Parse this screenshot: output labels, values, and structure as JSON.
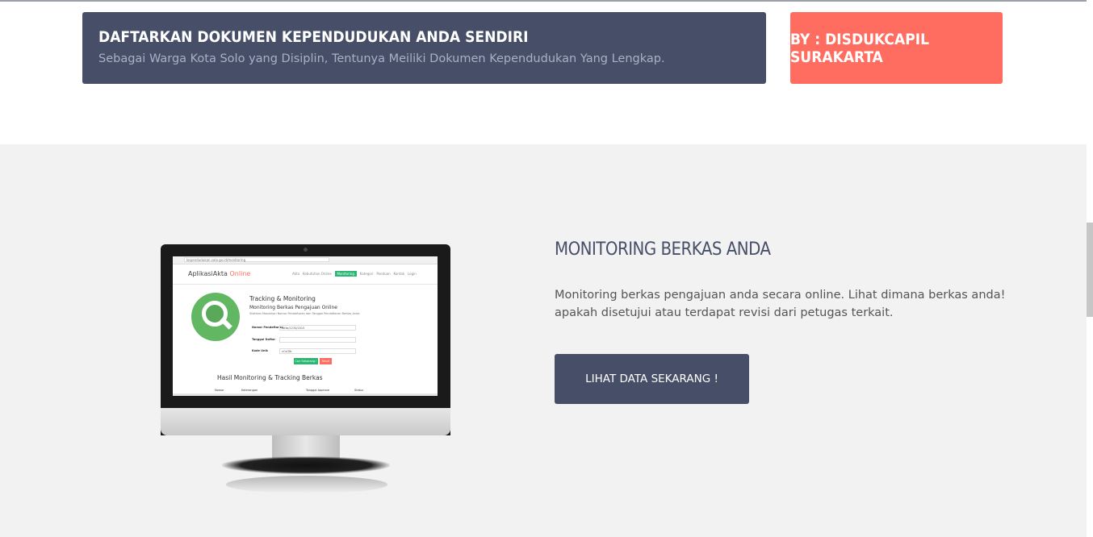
{
  "banner": {
    "title": "DAFTARKAN DOKUMEN KEPENDUDUKAN ANDA SENDIRI",
    "subtitle": "Sebagai Warga Kota Solo yang Disiplin, Tentunya Meiliki Dokumen Kependudukan Yang Lengkap.",
    "by_label": "BY : DISDUKCAPIL SURAKARTA"
  },
  "monitoring": {
    "title": "MONITORING BERKAS ANDA",
    "description": "Monitoring berkas pengajuan anda secara online. Lihat dimana berkas anda! apakah disetujui atau terdapat revisi dari petugas terkait.",
    "button_label": "LIHAT DATA SEKARANG !"
  },
  "screen": {
    "url": "kependudukan.solo.go.id/monitoring",
    "brand_main": "AplikasiAkta",
    "brand_accent": "Online",
    "nav": [
      "Akta",
      "Kebutuhan Online",
      "Monitoring",
      "Kategori",
      "Panduan",
      "Kontak",
      "Login"
    ],
    "heading": "Tracking & Monitoring",
    "subheading": "Monitoring Berkas Pengajuan Online",
    "instruction": "Silahkan Masukkan Nomor Pendaftaran dan Tanggal Pendaftaran Berkas Anda",
    "fields": [
      {
        "label": "Nomor Pendaftaran",
        "value": "AKta/1234/2015"
      },
      {
        "label": "Tanggal Daftar",
        "value": ""
      },
      {
        "label": "Kode Unik",
        "value": "vCsO8r"
      }
    ],
    "search_btn": "Cari Sekarang !",
    "reset_btn": "Reset",
    "results_title": "Hasil Monitoring & Tracking Berkas",
    "columns": [
      "Nomor",
      "Keterangan",
      "Tanggal Approve",
      "Status"
    ]
  },
  "colors": {
    "navy": "#474f68",
    "coral": "#ff6d60",
    "green": "#2bb673",
    "section_bg": "#f2f2f2"
  },
  "icons": {
    "search_graphic": "magnifier-icon"
  }
}
